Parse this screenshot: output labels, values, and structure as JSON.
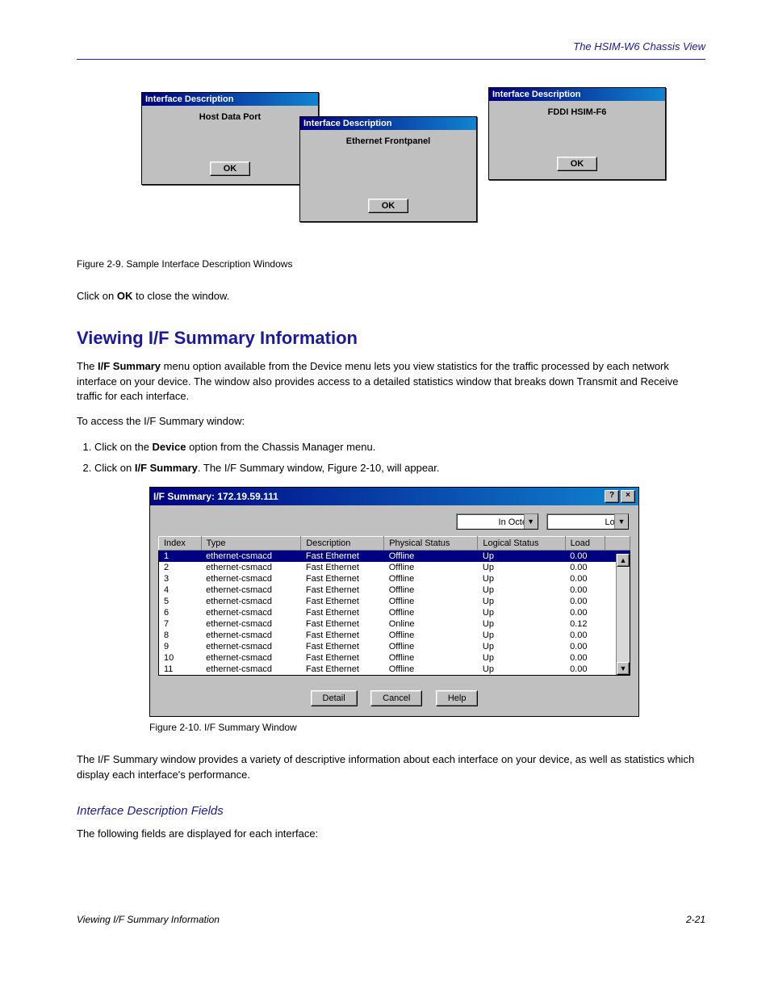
{
  "header": {
    "right": "The HSIM-W6 Chassis View"
  },
  "dialogs": {
    "title": "Interface Description",
    "d1_text": "Host Data Port",
    "d2_text": "Ethernet Frontpanel",
    "d3_text": "FDDI HSIM-F6",
    "ok": "OK"
  },
  "fig1_caption": "Figure 2-9. Sample Interface Description Windows",
  "para1": "Click on <b>OK</b> to close the window.",
  "h2": "Viewing I/F Summary Information",
  "para2": "The <b>I/F Summary</b> menu option available from the Device menu lets you view statistics for the traffic processed by each network interface on your device. The window also provides access to a detailed statistics window that breaks down Transmit and Receive traffic for each interface.",
  "para3": "To access the I/F Summary window:",
  "steps": {
    "s1": "Click on the <b>Device</b> option from the Chassis Manager menu.",
    "s2": "Click on <b>I/F Summary</b>. The I/F Summary window, Figure 2-10, will appear."
  },
  "ifwin": {
    "title": "I/F Summary: 172.19.59.111",
    "help_icon": "?",
    "close_icon": "×",
    "combo1": "In Octets",
    "combo2": "Load",
    "columns": [
      "Index",
      "Type",
      "Description",
      "Physical Status",
      "Logical Status",
      "Load"
    ],
    "rows": [
      {
        "idx": "1",
        "type": "ethernet-csmacd",
        "desc": "Fast Ethernet",
        "phys": "Offline",
        "log": "Up",
        "load": "0.00",
        "selected": true
      },
      {
        "idx": "2",
        "type": "ethernet-csmacd",
        "desc": "Fast Ethernet",
        "phys": "Offline",
        "log": "Up",
        "load": "0.00"
      },
      {
        "idx": "3",
        "type": "ethernet-csmacd",
        "desc": "Fast Ethernet",
        "phys": "Offline",
        "log": "Up",
        "load": "0.00"
      },
      {
        "idx": "4",
        "type": "ethernet-csmacd",
        "desc": "Fast Ethernet",
        "phys": "Offline",
        "log": "Up",
        "load": "0.00"
      },
      {
        "idx": "5",
        "type": "ethernet-csmacd",
        "desc": "Fast Ethernet",
        "phys": "Offline",
        "log": "Up",
        "load": "0.00"
      },
      {
        "idx": "6",
        "type": "ethernet-csmacd",
        "desc": "Fast Ethernet",
        "phys": "Offline",
        "log": "Up",
        "load": "0.00"
      },
      {
        "idx": "7",
        "type": "ethernet-csmacd",
        "desc": "Fast Ethernet",
        "phys": "Online",
        "log": "Up",
        "load": "0.12"
      },
      {
        "idx": "8",
        "type": "ethernet-csmacd",
        "desc": "Fast Ethernet",
        "phys": "Offline",
        "log": "Up",
        "load": "0.00"
      },
      {
        "idx": "9",
        "type": "ethernet-csmacd",
        "desc": "Fast Ethernet",
        "phys": "Offline",
        "log": "Up",
        "load": "0.00"
      },
      {
        "idx": "10",
        "type": "ethernet-csmacd",
        "desc": "Fast Ethernet",
        "phys": "Offline",
        "log": "Up",
        "load": "0.00"
      },
      {
        "idx": "11",
        "type": "ethernet-csmacd",
        "desc": "Fast Ethernet",
        "phys": "Offline",
        "log": "Up",
        "load": "0.00"
      }
    ],
    "buttons": {
      "detail": "Detail",
      "cancel": "Cancel",
      "help": "Help"
    }
  },
  "fig2_caption": "Figure 2-10. I/F Summary Window",
  "para4": "The I/F Summary window provides a variety of descriptive information about each interface on your device, as well as statistics which display each interface's performance.",
  "h3": "Interface Description Fields",
  "para5": "The following fields are displayed for each interface:",
  "footer": {
    "left": "Viewing I/F Summary Information",
    "right": "2-21"
  }
}
